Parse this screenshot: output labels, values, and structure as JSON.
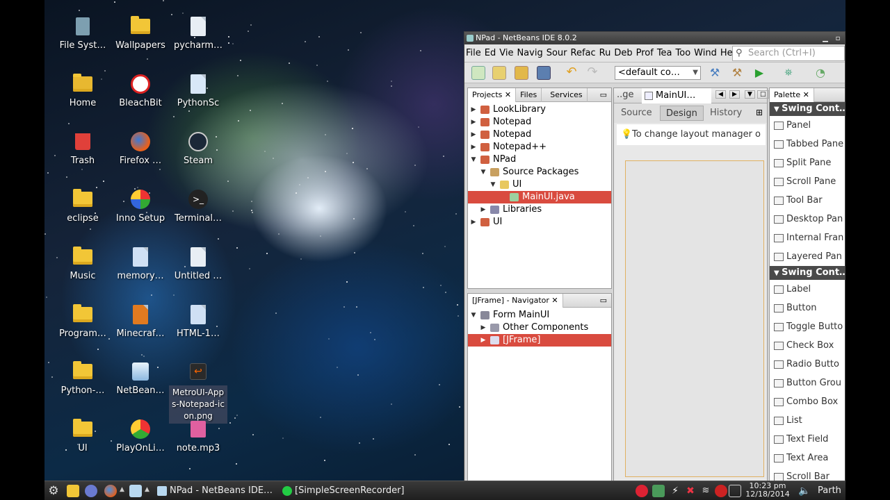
{
  "desktop": {
    "icons": [
      {
        "label": "File Syst…",
        "icon": "filesystem-icon"
      },
      {
        "label": "Wallpapers",
        "icon": "folder-icon"
      },
      {
        "label": "pycharm…",
        "icon": "file-icon"
      },
      {
        "label": "Home",
        "icon": "home-folder-icon"
      },
      {
        "label": "BleachBit",
        "icon": "bleachbit-icon"
      },
      {
        "label": "PythonSc",
        "icon": "python-icon"
      },
      {
        "label": "Trash",
        "icon": "trash-icon"
      },
      {
        "label": "Firefox …",
        "icon": "firefox-icon"
      },
      {
        "label": "Steam",
        "icon": "steam-icon"
      },
      {
        "label": "eclipse",
        "icon": "folder-icon"
      },
      {
        "label": "Inno Setup",
        "icon": "inno-setup-icon"
      },
      {
        "label": "Terminal…",
        "icon": "terminal-icon"
      },
      {
        "label": "Music",
        "icon": "folder-icon"
      },
      {
        "label": "memory…",
        "icon": "web-file-icon"
      },
      {
        "label": "Untitled …",
        "icon": "text-file-icon"
      },
      {
        "label": "Program…",
        "icon": "folder-icon"
      },
      {
        "label": "Minecraf…",
        "icon": "jar-file-icon"
      },
      {
        "label": "HTML-1…",
        "icon": "web-file-icon"
      },
      {
        "label": "Python-…",
        "icon": "folder-icon"
      },
      {
        "label": "NetBean…",
        "icon": "netbeans-icon"
      },
      {
        "label": "MetroUI-Apps-Notepad-icon.png",
        "icon": "image-file-icon"
      },
      {
        "label": "UI",
        "icon": "folder-icon"
      },
      {
        "label": "PlayOnLi…",
        "icon": "playonlinux-icon"
      },
      {
        "label": "note.mp3",
        "icon": "audio-file-icon"
      }
    ]
  },
  "window": {
    "title": "NPad - NetBeans IDE 8.0.2",
    "menu": [
      "File",
      "Ed",
      "Vie",
      "Navig",
      "Sour",
      "Refac",
      "Ru",
      "Deb",
      "Prof",
      "Tea",
      "Too",
      "Wind",
      "He"
    ],
    "search_placeholder": "Search (Ctrl+I)",
    "config_value": "<default co…"
  },
  "projects_panel": {
    "tabs": [
      "Projects",
      "Files",
      "Services"
    ],
    "tree": [
      {
        "label": "LookLibrary",
        "depth": 0,
        "expanded": false,
        "selected": false
      },
      {
        "label": "Notepad",
        "depth": 0,
        "expanded": false,
        "selected": false
      },
      {
        "label": "Notepad",
        "depth": 0,
        "expanded": false,
        "selected": false
      },
      {
        "label": "Notepad++",
        "depth": 0,
        "expanded": false,
        "selected": false
      },
      {
        "label": "NPad",
        "depth": 0,
        "expanded": true,
        "selected": false
      },
      {
        "label": "Source Packages",
        "depth": 1,
        "expanded": true,
        "selected": false
      },
      {
        "label": "UI",
        "depth": 2,
        "expanded": true,
        "selected": false
      },
      {
        "label": "MainUI.java",
        "depth": 3,
        "expanded": null,
        "selected": true
      },
      {
        "label": "Libraries",
        "depth": 1,
        "expanded": false,
        "selected": false
      },
      {
        "label": "UI",
        "depth": 0,
        "expanded": false,
        "selected": false
      }
    ]
  },
  "navigator_panel": {
    "title": "[JFrame] - Navigator",
    "tree": [
      {
        "label": "Form MainUI",
        "depth": 0,
        "expanded": true,
        "selected": false
      },
      {
        "label": "Other Components",
        "depth": 1,
        "expanded": false,
        "selected": false
      },
      {
        "label": "[JFrame]",
        "depth": 1,
        "expanded": false,
        "selected": true
      }
    ]
  },
  "editor": {
    "prev_tab": "..ge",
    "active_tab": "MainUI…",
    "subtabs": [
      "Source",
      "Design",
      "History"
    ],
    "active_subtab": "Design",
    "hint": "To change layout manager o"
  },
  "palette": {
    "title": "Palette",
    "categories": [
      {
        "name": "Swing Cont…",
        "items": [
          "Panel",
          "Tabbed Pane",
          "Split Pane",
          "Scroll Pane",
          "Tool Bar",
          "Desktop Pan",
          "Internal Fran",
          "Layered Pan"
        ]
      },
      {
        "name": "Swing Cont…",
        "items": [
          "Label",
          "Button",
          "Toggle Butto",
          "Check Box",
          "Radio Butto",
          "Button Grou",
          "Combo Box",
          "List",
          "Text Field",
          "Text Area",
          "Scroll Bar"
        ]
      }
    ]
  },
  "taskbar": {
    "tasks": [
      "NPad - NetBeans IDE…",
      "[SimpleScreenRecorder]"
    ],
    "time": "10:23 pm",
    "date": "12/18/2014",
    "user": "Parth"
  },
  "colors": {
    "selection": "#d94b3f",
    "folder": "#f2c637"
  }
}
